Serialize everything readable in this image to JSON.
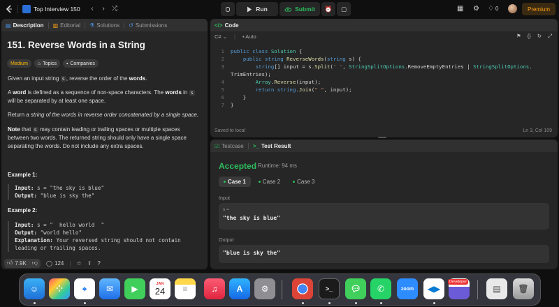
{
  "topbar": {
    "list_title": "Top Interview 150",
    "run_label": "Run",
    "submit_label": "Submit",
    "streak_count": "0",
    "premium_label": "Premium"
  },
  "left_panel": {
    "tabs": [
      "Description",
      "Editorial",
      "Solutions",
      "Submissions"
    ],
    "title": "151. Reverse Words in a String",
    "badges": [
      "Medium",
      "Topics",
      "Companies"
    ],
    "p1_a": "Given an input string ",
    "p1_code": "s",
    "p1_b": ", reverse the order of the ",
    "p1_bold": "words",
    "p1_c": ".",
    "p2_a": "A ",
    "p2_bold1": "word",
    "p2_b": " is defined as a sequence of non-space characters. The ",
    "p2_bold2": "words",
    "p2_c": " in ",
    "p2_code": "s",
    "p2_d": "will be separated by at least one space.",
    "p3_a": "Return ",
    "p3_em": "a string of the words in reverse order concatenated by a single space.",
    "p4_bold": "Note",
    "p4_a": " that ",
    "p4_code": "s",
    "p4_b": " may contain leading or trailing spaces or multiple spaces",
    "p4_c": "between two words. The returned string should only have a single space",
    "p4_d": "separating the words. Do not include any extra spaces.",
    "ex1_title": "Example 1:",
    "ex1_input_label": "Input:",
    "ex1_input": " s = \"the sky is blue\"",
    "ex1_output_label": "Output:",
    "ex1_output": " \"blue is sky the\"",
    "ex2_title": "Example 2:",
    "ex2_input_label": "Input:",
    "ex2_input": " s = \"  hello world  \"",
    "ex2_output_label": "Output:",
    "ex2_output": " \"world hello\"",
    "ex2_expl_label": "Explanation:",
    "ex2_expl_a": " Your reversed string should not contain",
    "ex2_expl_b": "leading or trailing spaces.",
    "likes": "7.9K",
    "comments": "124"
  },
  "code_panel": {
    "title": "Code",
    "language": "C#",
    "mode": "Auto",
    "lines": [
      "1",
      "2",
      "3",
      "",
      "4",
      "5",
      "6",
      "7"
    ],
    "status": "Saved to local",
    "position": "Ln 3, Col 109"
  },
  "result_panel": {
    "tabs": [
      "Testcase",
      "Test Result"
    ],
    "status": "Accepted",
    "runtime": "Runtime: 94 ms",
    "cases": [
      "Case 1",
      "Case 2",
      "Case 3"
    ],
    "input_label": "Input",
    "input_var": "s =",
    "input_value": "\"the sky is blue\"",
    "output_label": "Output",
    "output_value": "\"blue is sky the\""
  },
  "dock": {
    "calendar_month": "JAN",
    "calendar_day": "24",
    "developer_label": "Developer"
  }
}
